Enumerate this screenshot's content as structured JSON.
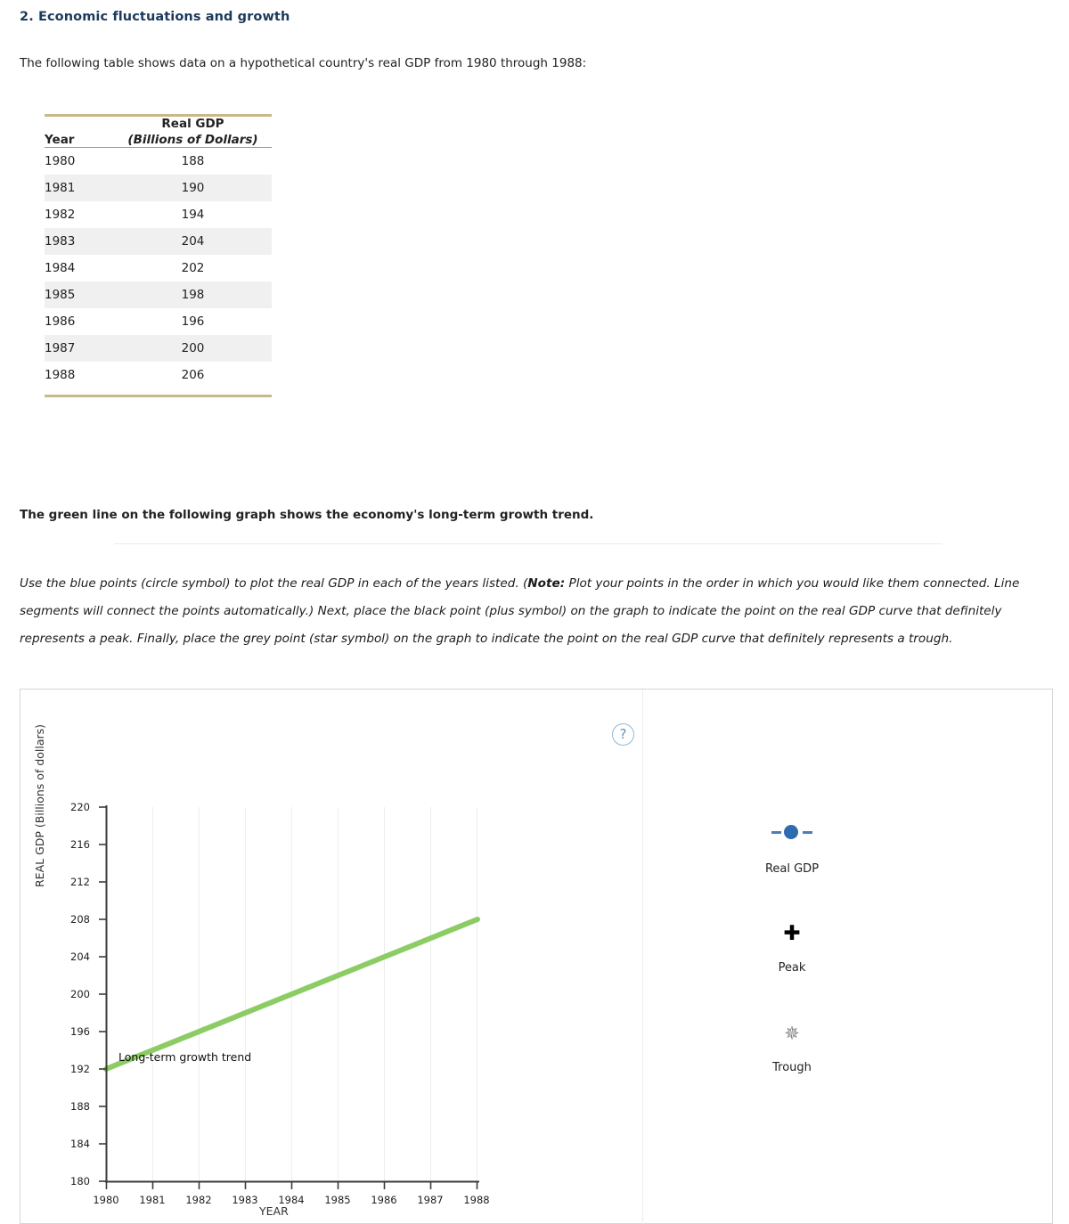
{
  "question": {
    "number_title": "2. Economic fluctuations and growth",
    "intro": "The following table shows data on a hypothetical country's real GDP from 1980 through 1988:"
  },
  "table": {
    "header_year": "Year",
    "header_gdp_line1": "Real GDP",
    "header_gdp_line2": "(Billions of Dollars)",
    "rows": [
      {
        "year": "1980",
        "gdp": "188"
      },
      {
        "year": "1981",
        "gdp": "190"
      },
      {
        "year": "1982",
        "gdp": "194"
      },
      {
        "year": "1983",
        "gdp": "204"
      },
      {
        "year": "1984",
        "gdp": "202"
      },
      {
        "year": "1985",
        "gdp": "198"
      },
      {
        "year": "1986",
        "gdp": "196"
      },
      {
        "year": "1987",
        "gdp": "200"
      },
      {
        "year": "1988",
        "gdp": "206"
      }
    ]
  },
  "body": {
    "green_note": "The green line on the following graph shows the economy's long-term growth trend.",
    "instructions_part1": "Use the blue points (circle symbol) to plot the real GDP in each of the years listed. (",
    "instructions_note_bold": "Note:",
    "instructions_part2": " Plot your points in the order in which you would like them connected. Line segments will connect the points automatically.) Next, place the black point (plus symbol) on the graph to indicate the point on the real GDP curve that definitely represents a peak. Finally, place the grey point (star symbol) on the graph to indicate the point on the real GDP curve that definitely represents a trough."
  },
  "panel": {
    "help_label": "?",
    "legend": [
      {
        "symbol": "circle-line-symbol",
        "label": "Real GDP"
      },
      {
        "symbol": "plus-symbol",
        "label": "Peak"
      },
      {
        "symbol": "star-symbol",
        "label": "Trough"
      }
    ]
  },
  "chart_data": {
    "type": "line",
    "title": "",
    "xlabel": "YEAR",
    "ylabel": "REAL GDP (Billions of dollars)",
    "xlim": [
      1979.5,
      1988.5
    ],
    "ylim": [
      180,
      220
    ],
    "yticks": [
      "220",
      "216",
      "212",
      "208",
      "204",
      "200",
      "196",
      "192",
      "188",
      "184",
      "180"
    ],
    "xticks": [
      "1980",
      "1981",
      "1982",
      "1983",
      "1984",
      "1985",
      "1986",
      "1987",
      "1988"
    ],
    "grid": true,
    "series": [
      {
        "name": "Long-term growth trend",
        "color": "#8ccc64",
        "annotation": "Long-term growth trend",
        "x": [
          "1980",
          "1988"
        ],
        "values": [
          192,
          208
        ]
      }
    ],
    "data_to_plot": {
      "name": "Real GDP",
      "categories": [
        "1980",
        "1981",
        "1982",
        "1983",
        "1984",
        "1985",
        "1986",
        "1987",
        "1988"
      ],
      "values": [
        188,
        190,
        194,
        204,
        202,
        198,
        196,
        200,
        206
      ],
      "plotted": false
    }
  },
  "colors": {
    "title": "#1b3a5c",
    "table_rule": "#c8b88a",
    "trend_green": "#8ccc64",
    "point_blue": "#2f6bb0",
    "trough_grey": "#8a8a8a"
  }
}
